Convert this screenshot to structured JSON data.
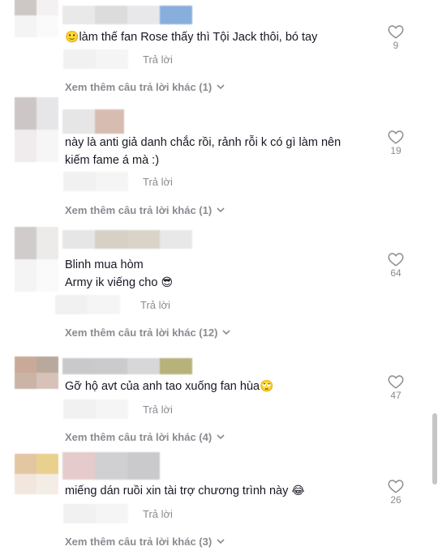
{
  "reply_label": "Trả lời",
  "comments": [
    {
      "lines": [
        "làm thế fan Rose thấy thì Tội Jack thôi, bó tay"
      ],
      "emoji_before": "🙂",
      "likes": "9",
      "more_replies": "Xem thêm câu trả lời khác (1)"
    },
    {
      "lines": [
        "này là anti giả danh chắc rồi, rảnh rỗi k có gì làm nên",
        "kiếm fame á mà :)"
      ],
      "likes": "19",
      "more_replies": "Xem thêm câu trả lời khác (1)"
    },
    {
      "lines": [
        "Blinh mua hòm",
        "Army ik viếng cho"
      ],
      "emoji_after": "😎",
      "likes": "64",
      "more_replies": "Xem thêm câu trả lời khác (12)"
    },
    {
      "lines": [
        "Gỡ hộ avt của anh tao xuống fan hùa"
      ],
      "emoji_after": "🙄",
      "likes": "47",
      "more_replies": "Xem thêm câu trả lời khác (4)"
    },
    {
      "lines": [
        "miếng dán ruồi xin tài trợ chương trình này"
      ],
      "emoji_after": "😂",
      "likes": "26",
      "more_replies": "Xem thêm câu trả lời khác (3)"
    }
  ]
}
